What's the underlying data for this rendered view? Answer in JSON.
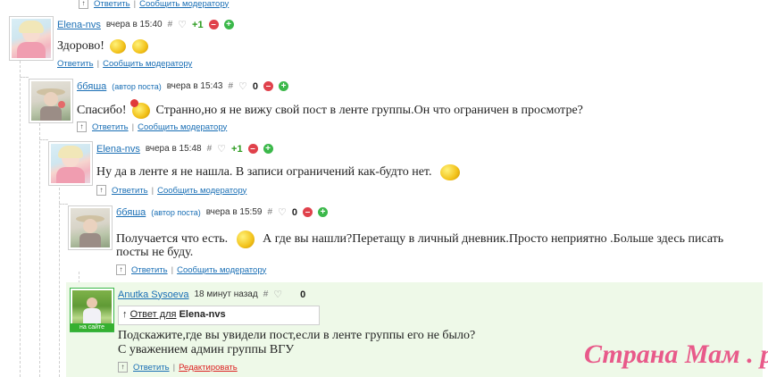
{
  "top_links": {
    "reply": "Ответить",
    "report": "Сообщить модератору"
  },
  "comments": [
    {
      "author": "Elena-nvs",
      "time": "вчера в 15:40",
      "hash": "#",
      "score": "+1",
      "text_before": "Здорово!",
      "text_after": "",
      "reply": "Ответить",
      "report": "Сообщить модератору"
    },
    {
      "author": "ббяша",
      "badge": "(автор поста)",
      "time": "вчера в 15:43",
      "hash": "#",
      "score": "0",
      "text_before": "Спасибо!",
      "text_after": "Странно,но я не вижу свой пост в ленте группы.Он что ограничен в просмотре?",
      "reply": "Ответить",
      "report": "Сообщить модератору"
    },
    {
      "author": "Elena-nvs",
      "time": "вчера в 15:48",
      "hash": "#",
      "score": "+1",
      "text_before": "Ну да в ленте я не нашла. В записи ограничений как-будто нет.",
      "text_after": "",
      "reply": "Ответить",
      "report": "Сообщить модератору"
    },
    {
      "author": "ббяша",
      "badge": "(автор поста)",
      "time": "вчера в 15:59",
      "hash": "#",
      "score": "0",
      "text_before": "Получается что есть.",
      "text_after": "А где вы нашли?Перетащу в личный дневник.Просто неприятно .Больше здесь писать",
      "text_line2": "посты не буду.",
      "reply": "Ответить",
      "report": "Сообщить модератору"
    },
    {
      "author": "Anutka Sysoeva",
      "time": "18 минут назад",
      "hash": "#",
      "score": "0",
      "online": "на сайте",
      "reply_to_prefix": "Ответ для",
      "reply_to_name": "Elena-nvs",
      "text_before": "Подскажите,где вы увидели пост,если в ленте группы его не было?",
      "text_line2": "С уважением админ группы ВГУ",
      "reply": "Ответить",
      "edit": "Редактировать"
    }
  ],
  "vote": {
    "minus": "–",
    "plus": "+",
    "heart": "♡",
    "up": "↑"
  },
  "watermark": "Страна Мам . ру"
}
